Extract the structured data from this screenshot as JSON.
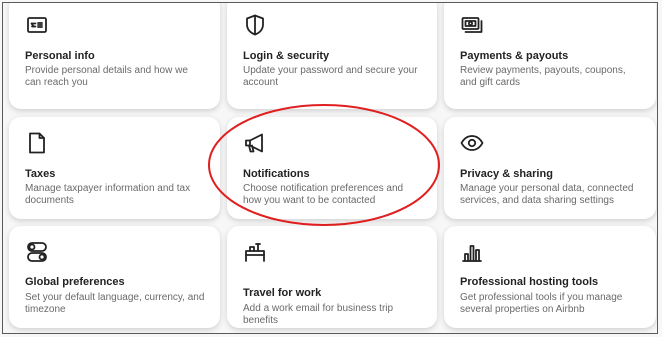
{
  "cards": [
    {
      "title": "Personal info",
      "description": "Provide personal details and how we can reach you",
      "icon": "id-card-icon"
    },
    {
      "title": "Login & security",
      "description": "Update your password and secure your account",
      "icon": "shield-icon"
    },
    {
      "title": "Payments & payouts",
      "description": "Review payments, payouts, coupons, and gift cards",
      "icon": "payments-icon"
    },
    {
      "title": "Taxes",
      "description": "Manage taxpayer information and tax documents",
      "icon": "document-icon"
    },
    {
      "title": "Notifications",
      "description": "Choose notification preferences and how you want to be contacted",
      "icon": "megaphone-icon"
    },
    {
      "title": "Privacy & sharing",
      "description": "Manage your personal data, connected services, and data sharing settings",
      "icon": "eye-icon"
    },
    {
      "title": "Global preferences",
      "description": "Set your default language, currency, and timezone",
      "icon": "toggles-icon"
    },
    {
      "title": "Travel for work",
      "description": "Add a work email for business trip benefits",
      "icon": "briefcase-desk-icon"
    },
    {
      "title": "Professional hosting tools",
      "description": "Get professional tools if you manage several properties on Airbnb",
      "icon": "bar-chart-icon"
    }
  ],
  "annotation": {
    "shape": "ellipse",
    "color": "#e02020",
    "target": "Notifications"
  }
}
